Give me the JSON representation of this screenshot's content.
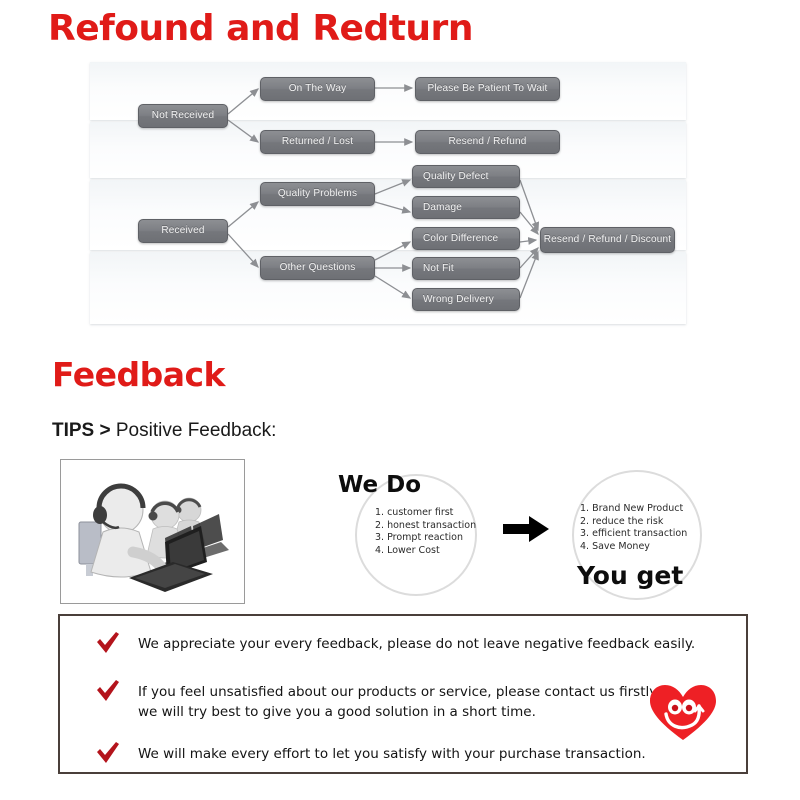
{
  "headings": {
    "refund": "Refound and Redturn",
    "feedback": "Feedback"
  },
  "tips": {
    "prefix": "TIPS >",
    "text": " Positive Feedback:"
  },
  "flowchart": {
    "nodes": [
      {
        "id": "not-received",
        "label": "Not Received"
      },
      {
        "id": "on-the-way",
        "label": "On The Way"
      },
      {
        "id": "please-be-patient",
        "label": "Please Be Patient To Wait"
      },
      {
        "id": "returned-lost",
        "label": "Returned / Lost"
      },
      {
        "id": "resend-refund",
        "label": "Resend / Refund"
      },
      {
        "id": "received",
        "label": "Received"
      },
      {
        "id": "quality-problems",
        "label": "Quality Problems"
      },
      {
        "id": "other-questions",
        "label": "Other Questions"
      },
      {
        "id": "quality-defect",
        "label": "Quality Defect"
      },
      {
        "id": "damage",
        "label": "Damage"
      },
      {
        "id": "color-difference",
        "label": "Color Difference"
      },
      {
        "id": "not-fit",
        "label": "Not Fit"
      },
      {
        "id": "wrong-delivery",
        "label": "Wrong Delivery"
      },
      {
        "id": "resend-refund-discount",
        "label": "Resend / Refund / Discount"
      }
    ],
    "node_fill": "#7b7d82",
    "node_text_color": "#f2f2f2"
  },
  "we_do": {
    "title": "We Do",
    "items": [
      "1. customer first",
      "2. honest transaction",
      "3. Prompt reaction",
      "4. Lower Cost"
    ]
  },
  "you_get": {
    "title": "You get",
    "items": [
      "1. Brand New Product",
      "2. reduce the risk",
      "3. efficient transaction",
      "4. Save Money"
    ]
  },
  "promises": [
    "We appreciate your every feedback, please do not leave negative feedback easily.",
    "If you feel unsatisfied about our products or service, please contact us firstly, we will try best to give you a good solution in a short time.",
    "We will make every effort to let you satisfy with your purchase transaction."
  ],
  "colors": {
    "heading_red": "#e01b18",
    "check_red": "#b4141c",
    "heart_red": "#ee2025",
    "box_border": "#4a3f3a"
  }
}
